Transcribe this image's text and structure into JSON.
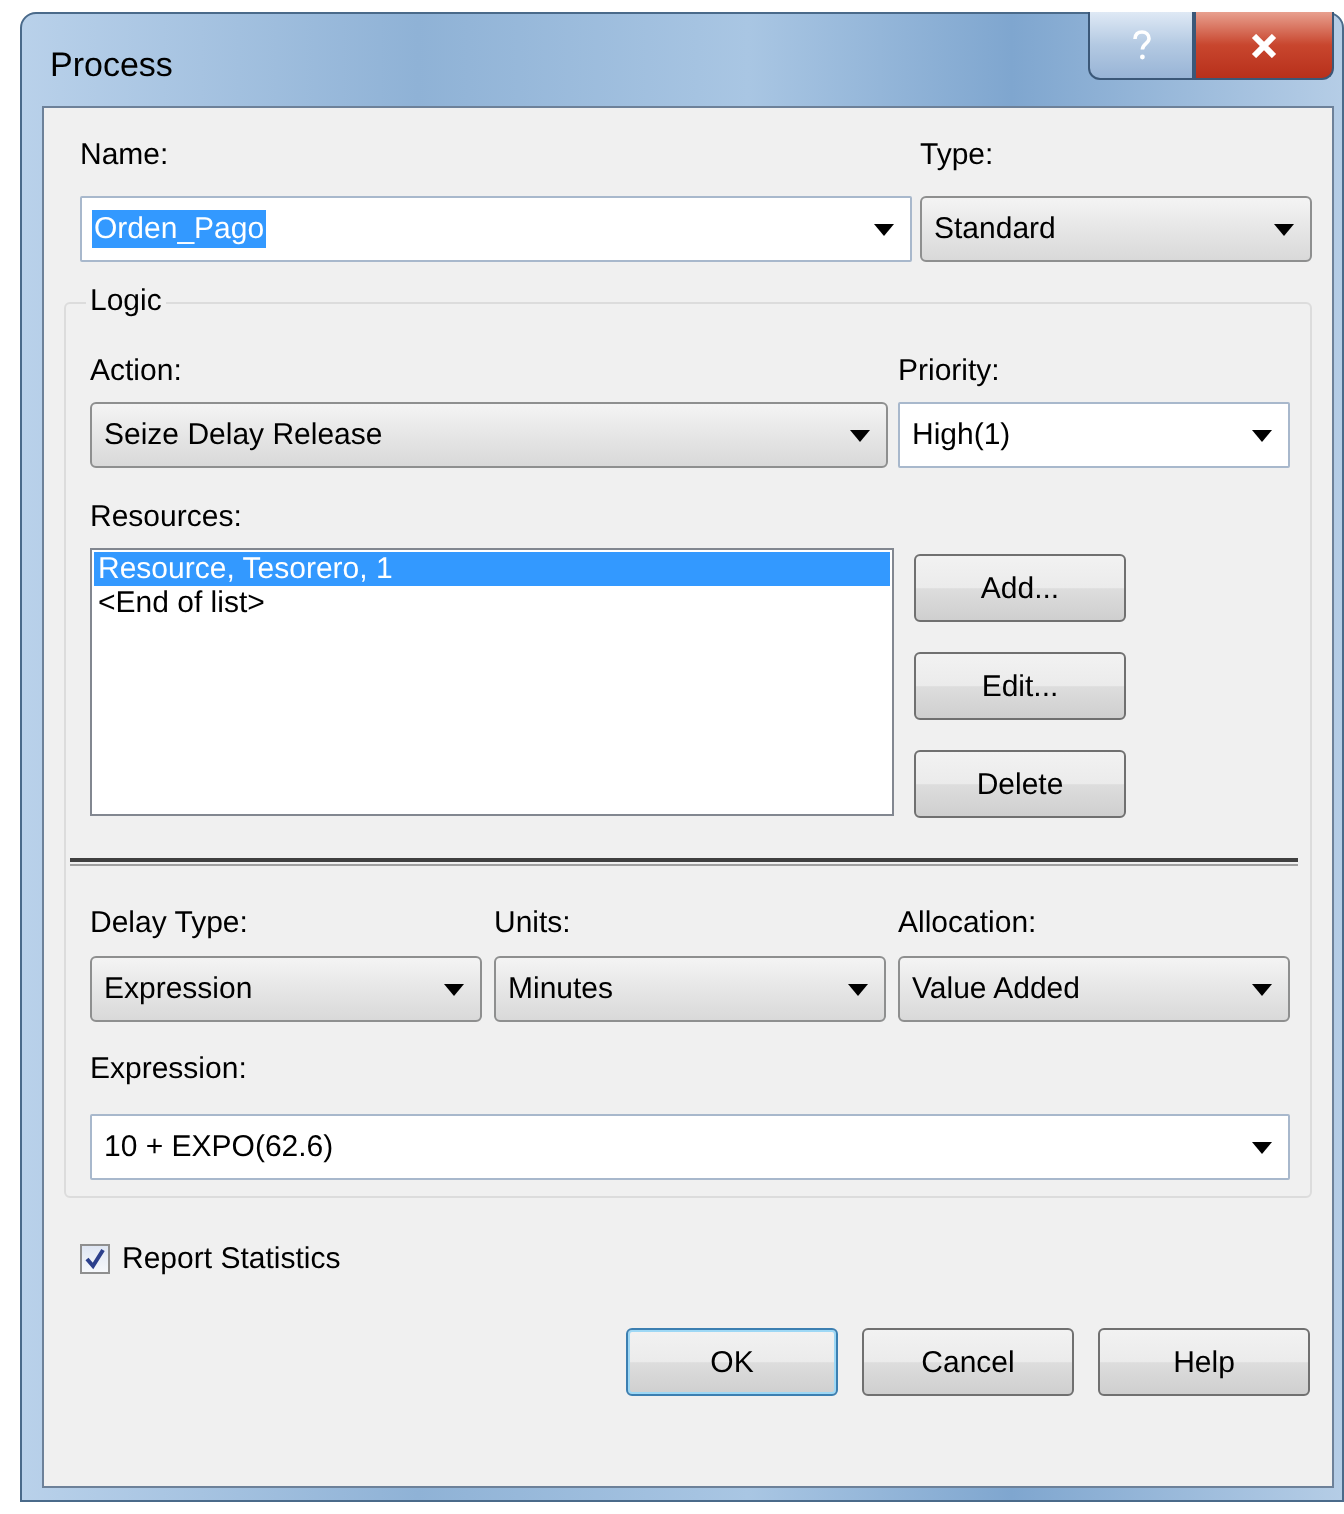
{
  "window": {
    "title": "Process"
  },
  "name": {
    "label": "Name:",
    "value": "Orden_Pago",
    "highlighted": true
  },
  "type": {
    "label": "Type:",
    "value": "Standard"
  },
  "logic": {
    "title": "Logic",
    "action": {
      "label": "Action:",
      "value": "Seize Delay Release"
    },
    "priority": {
      "label": "Priority:",
      "value": "High(1)"
    },
    "resources": {
      "label": "Resources:",
      "items": [
        {
          "text": "Resource, Tesorero, 1",
          "selected": true
        },
        {
          "text": "<End of list>",
          "selected": false
        }
      ],
      "buttons": [
        "Add...",
        "Edit...",
        "Delete"
      ]
    },
    "delay_type": {
      "label": "Delay Type:",
      "value": "Expression"
    },
    "units": {
      "label": "Units:",
      "value": "Minutes"
    },
    "allocation": {
      "label": "Allocation:",
      "value": "Value Added"
    },
    "expression": {
      "label": "Expression:",
      "value": "10 + EXPO(62.6)"
    }
  },
  "report_statistics": {
    "label": "Report Statistics",
    "checked": true
  },
  "buttons": [
    {
      "label": "OK",
      "default": true
    },
    {
      "label": "Cancel",
      "default": false
    },
    {
      "label": "Help",
      "default": false
    }
  ]
}
